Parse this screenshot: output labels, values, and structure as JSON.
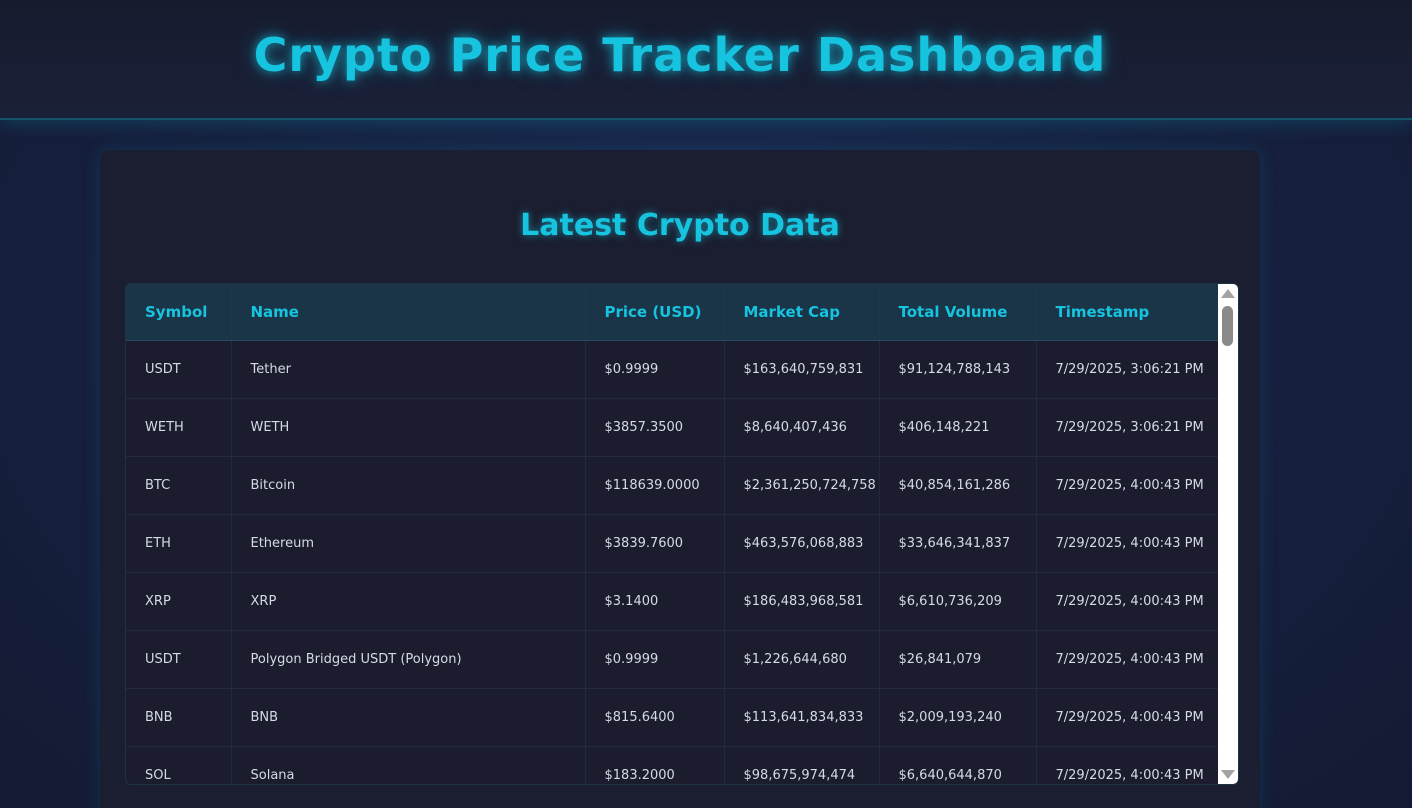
{
  "header": {
    "title": "Crypto Price Tracker Dashboard"
  },
  "main": {
    "section_title": "Latest Crypto Data",
    "table": {
      "columns": [
        "Symbol",
        "Name",
        "Price (USD)",
        "Market Cap",
        "Total Volume",
        "Timestamp"
      ],
      "rows": [
        [
          "USDT",
          "Tether",
          "$0.9999",
          "$163,640,759,831",
          "$91,124,788,143",
          "7/29/2025, 3:06:21 PM"
        ],
        [
          "WETH",
          "WETH",
          "$3857.3500",
          "$8,640,407,436",
          "$406,148,221",
          "7/29/2025, 3:06:21 PM"
        ],
        [
          "BTC",
          "Bitcoin",
          "$118639.0000",
          "$2,361,250,724,758",
          "$40,854,161,286",
          "7/29/2025, 4:00:43 PM"
        ],
        [
          "ETH",
          "Ethereum",
          "$3839.7600",
          "$463,576,068,883",
          "$33,646,341,837",
          "7/29/2025, 4:00:43 PM"
        ],
        [
          "XRP",
          "XRP",
          "$3.1400",
          "$186,483,968,581",
          "$6,610,736,209",
          "7/29/2025, 4:00:43 PM"
        ],
        [
          "USDT",
          "Polygon Bridged USDT (Polygon)",
          "$0.9999",
          "$1,226,644,680",
          "$26,841,079",
          "7/29/2025, 4:00:43 PM"
        ],
        [
          "BNB",
          "BNB",
          "$815.6400",
          "$113,641,834,833",
          "$2,009,193,240",
          "7/29/2025, 4:00:43 PM"
        ],
        [
          "SOL",
          "Solana",
          "$183.2000",
          "$98,675,974,474",
          "$6,640,644,870",
          "7/29/2025, 4:00:43 PM"
        ]
      ]
    }
  },
  "colors": {
    "accent": "#17c4e0",
    "header_bg": "#1a3448",
    "card_bg": "#1b1e30",
    "page_bg": "#172445"
  },
  "icons": [
    "scroll-up-arrow-icon",
    "scroll-down-arrow-icon"
  ]
}
